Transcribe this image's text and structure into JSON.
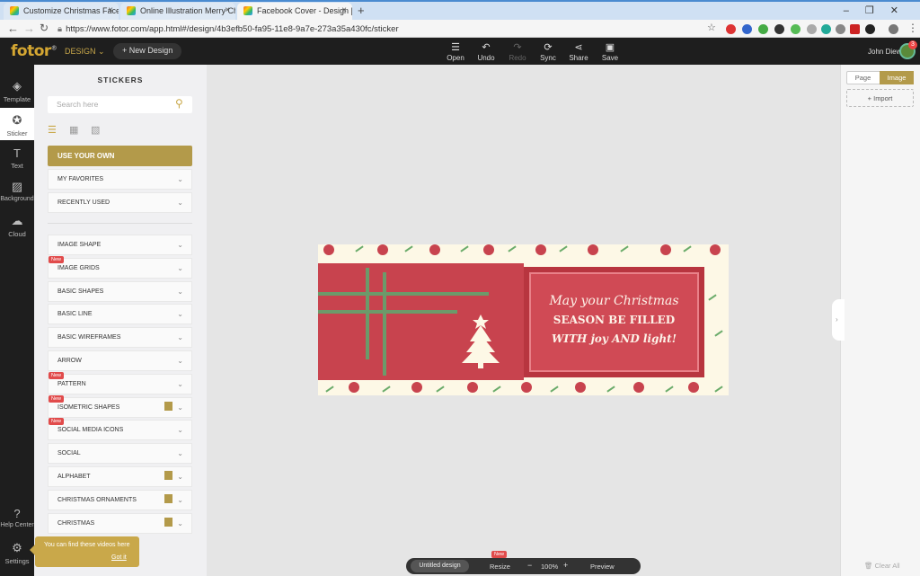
{
  "browser": {
    "tabs": [
      {
        "title": "Customize Christmas Facebook C",
        "active": false
      },
      {
        "title": "Online Illustration Merry Christm",
        "active": false
      },
      {
        "title": "Facebook Cover - Design | Fotor",
        "active": true
      }
    ],
    "new_tab": "+",
    "url": "https://www.fotor.com/app.html#/design/4b3efb50-fa95-11e8-9a7e-273a35a430fc/sticker"
  },
  "app": {
    "logo": "fotor",
    "design_menu": "DESIGN",
    "new_design": "+ New Design",
    "toolbar": [
      {
        "label": "Open",
        "icon": "menu-icon",
        "enabled": true
      },
      {
        "label": "Undo",
        "icon": "undo-icon",
        "enabled": true
      },
      {
        "label": "Redo",
        "icon": "redo-icon",
        "enabled": false
      },
      {
        "label": "Sync",
        "icon": "sync-icon",
        "enabled": true
      },
      {
        "label": "Share",
        "icon": "share-icon",
        "enabled": true
      },
      {
        "label": "Save",
        "icon": "save-icon",
        "enabled": true
      }
    ],
    "user": "John Diew",
    "notification_count": "3"
  },
  "rail": [
    {
      "label": "Template",
      "icon": "layers-icon"
    },
    {
      "label": "Sticker",
      "icon": "star-icon",
      "active": true
    },
    {
      "label": "Text",
      "icon": "text-icon"
    },
    {
      "label": "Background",
      "icon": "background-icon"
    },
    {
      "label": "Cloud",
      "icon": "cloud-icon"
    },
    {
      "label": "Help Center",
      "icon": "help-icon"
    },
    {
      "label": "Settings",
      "icon": "settings-icon"
    }
  ],
  "stickers": {
    "title": "STICKERS",
    "search_placeholder": "Search here",
    "use_own": "USE YOUR OWN",
    "top_items": [
      "MY FAVORITES",
      "RECENTLY USED"
    ],
    "categories": [
      {
        "label": "IMAGE SHAPE"
      },
      {
        "label": "IMAGE GRIDS",
        "new": true
      },
      {
        "label": "BASIC SHAPES"
      },
      {
        "label": "BASIC LINE"
      },
      {
        "label": "BASIC WIREFRAMES"
      },
      {
        "label": "ARROW"
      },
      {
        "label": "PATTERN",
        "new": true
      },
      {
        "label": "ISOMETRIC SHAPES",
        "new": true,
        "premium": true
      },
      {
        "label": "SOCIAL MEDIA ICONS",
        "new": true
      },
      {
        "label": "SOCIAL"
      },
      {
        "label": "ALPHABET",
        "premium": true
      },
      {
        "label": "CHRISTMAS ORNAMENTS",
        "premium": true
      },
      {
        "label": "CHRISTMAS",
        "premium": true
      }
    ],
    "new_tag": "New"
  },
  "canvas": {
    "message_lines": [
      "May your Christmas",
      "SEASON BE FILLED",
      "WITH joy AND light!"
    ]
  },
  "right_panel": {
    "tab_page": "Page",
    "tab_image": "Image",
    "import": "+ Import",
    "clear_all": "Clear All"
  },
  "bottom": {
    "design_name": "Untitled design",
    "resize": "Resize",
    "resize_new": "New",
    "zoom_out": "−",
    "zoom": "100%",
    "zoom_in": "+",
    "preview": "Preview"
  },
  "tooltip": {
    "text": "You can find these videos here",
    "got_it": "Got it"
  },
  "colors": {
    "accent": "#b39a4a",
    "cover_red": "#c8434e",
    "cover_green": "#6c9a6a"
  }
}
